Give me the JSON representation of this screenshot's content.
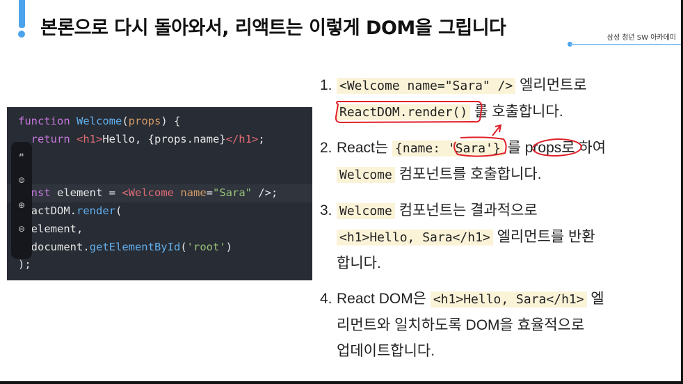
{
  "slide": {
    "title": "본론으로 다시 돌아와서, 리액트는 이렇게 DOM을 그립니다",
    "org": "삼성 청년 SW 아카데미"
  },
  "code": {
    "lines": [
      [
        [
          "kw",
          "function "
        ],
        [
          "fn",
          "Welcome"
        ],
        [
          "pl",
          "("
        ],
        [
          "attr",
          "props"
        ],
        [
          "pl",
          ") {"
        ]
      ],
      [
        [
          "pl",
          "  "
        ],
        [
          "kw",
          "return "
        ],
        [
          "tag",
          "<h1>"
        ],
        [
          "pl",
          "Hello, {props.name}"
        ],
        [
          "tag",
          "</h1>"
        ],
        [
          "pl",
          ";"
        ]
      ],
      [],
      [],
      [
        [
          "kw",
          "const "
        ],
        [
          "pl",
          "element = "
        ],
        [
          "tag",
          "<Welcome "
        ],
        [
          "attr",
          "name"
        ],
        [
          "pl",
          "="
        ],
        [
          "str",
          "\"Sara\""
        ],
        [
          "pl",
          " />;"
        ]
      ],
      [
        [
          "pl",
          "ReactDOM."
        ],
        [
          "fn",
          "render"
        ],
        [
          "pl",
          "("
        ]
      ],
      [
        [
          "pl",
          "  element,"
        ]
      ],
      [
        [
          "pl",
          "  document."
        ],
        [
          "fn",
          "getElementById"
        ],
        [
          "pl",
          "("
        ],
        [
          "str",
          "'root'"
        ],
        [
          "pl",
          ")"
        ]
      ],
      [
        [
          "pl",
          ");"
        ]
      ]
    ]
  },
  "toolbar": {
    "icons": [
      "pen-icon",
      "eraser-icon",
      "zoom-in-icon",
      "zoom-out-icon"
    ],
    "glyphs": [
      "𝓃",
      "⊜",
      "⊕",
      "⊖"
    ]
  },
  "steps": [
    {
      "num": "1.",
      "parts": [
        [
          "code",
          "<Welcome name=\"Sara\" />"
        ],
        [
          "text",
          " 엘리먼트로"
        ]
      ],
      "parts2": [
        [
          "code",
          "ReactDOM.render()"
        ],
        [
          "text",
          " 를 호출합니다."
        ]
      ]
    },
    {
      "num": "2.",
      "parts": [
        [
          "text",
          "React는 "
        ],
        [
          "code",
          "{name: 'Sara'}"
        ],
        [
          "text",
          " 를 props로 하여"
        ]
      ],
      "parts2": [
        [
          "code",
          "Welcome"
        ],
        [
          "text",
          " 컴포넌트를 호출합니다."
        ]
      ]
    },
    {
      "num": "3.",
      "parts": [
        [
          "code",
          "Welcome"
        ],
        [
          "text",
          " 컴포넌트는 결과적으로"
        ]
      ],
      "parts2": [
        [
          "code",
          "<h1>Hello, Sara</h1>"
        ],
        [
          "text",
          " 엘리먼트를 반환"
        ]
      ],
      "parts3": [
        [
          "text",
          "합니다."
        ]
      ]
    },
    {
      "num": "4.",
      "parts": [
        [
          "text",
          "React DOM은 "
        ],
        [
          "code",
          "<h1>Hello, Sara</h1>"
        ],
        [
          "text",
          " 엘"
        ]
      ],
      "parts2": [
        [
          "text",
          "리먼트와 일치하도록 DOM을 효율적으로"
        ]
      ],
      "parts3": [
        [
          "text",
          "업데이트합니다."
        ]
      ]
    }
  ],
  "colors": {
    "accent": "#4aa3ec",
    "annotation": "#e0202a",
    "code_bg": "#282c34"
  }
}
